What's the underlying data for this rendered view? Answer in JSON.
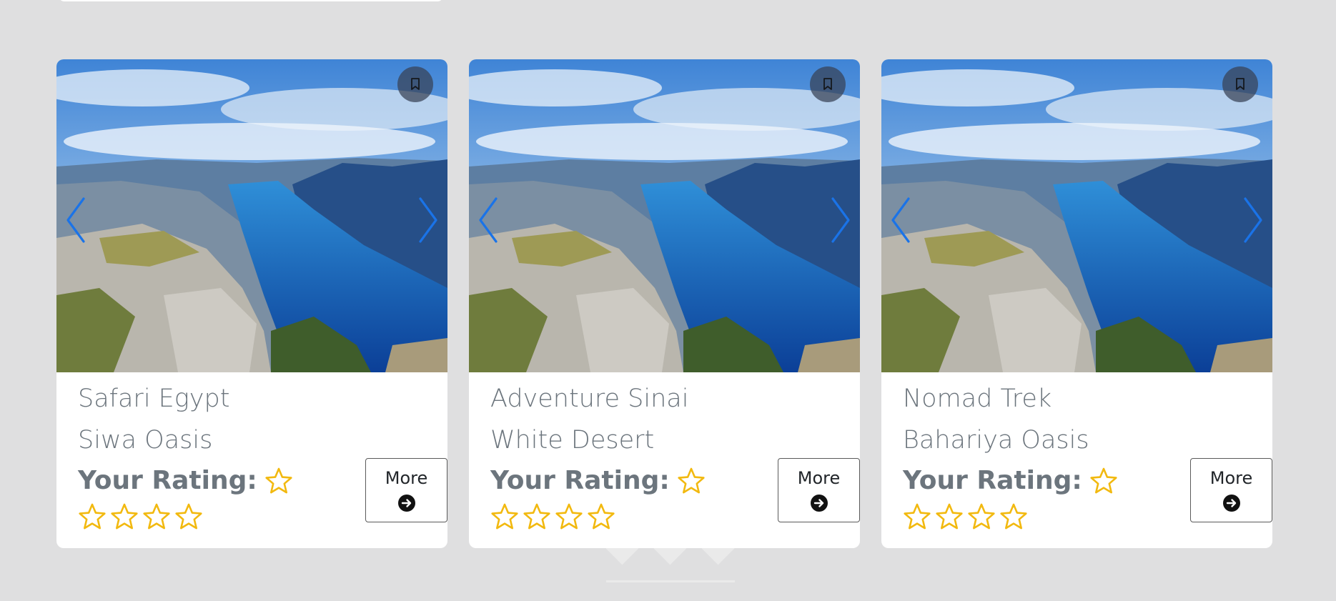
{
  "colors": {
    "background": "#dfdfe0",
    "card": "#ffffff",
    "text_muted": "#6c757d",
    "star": "#f2b90f",
    "nav_arrow": "#1a73e8",
    "bookmark_bg": "#374155"
  },
  "cards": [
    {
      "title": "Safari Egypt",
      "location": "Siwa Oasis",
      "rating_label": "Your Rating:",
      "stars": 4,
      "more_label": "More",
      "icons": [
        "bookmark-icon",
        "chevron-left-icon",
        "chevron-right-icon",
        "star-outline-icon",
        "arrow-circle-right-icon"
      ]
    },
    {
      "title": "Adventure Sinai",
      "location": "White Desert",
      "rating_label": "Your Rating:",
      "stars": 4,
      "more_label": "More",
      "icons": [
        "bookmark-icon",
        "chevron-left-icon",
        "chevron-right-icon",
        "star-outline-icon",
        "arrow-circle-right-icon"
      ]
    },
    {
      "title": "Nomad Trek",
      "location": "Bahariya Oasis",
      "rating_label": "Your Rating:",
      "stars": 4,
      "more_label": "More",
      "icons": [
        "bookmark-icon",
        "chevron-left-icon",
        "chevron-right-icon",
        "star-outline-icon",
        "arrow-circle-right-icon"
      ]
    }
  ]
}
